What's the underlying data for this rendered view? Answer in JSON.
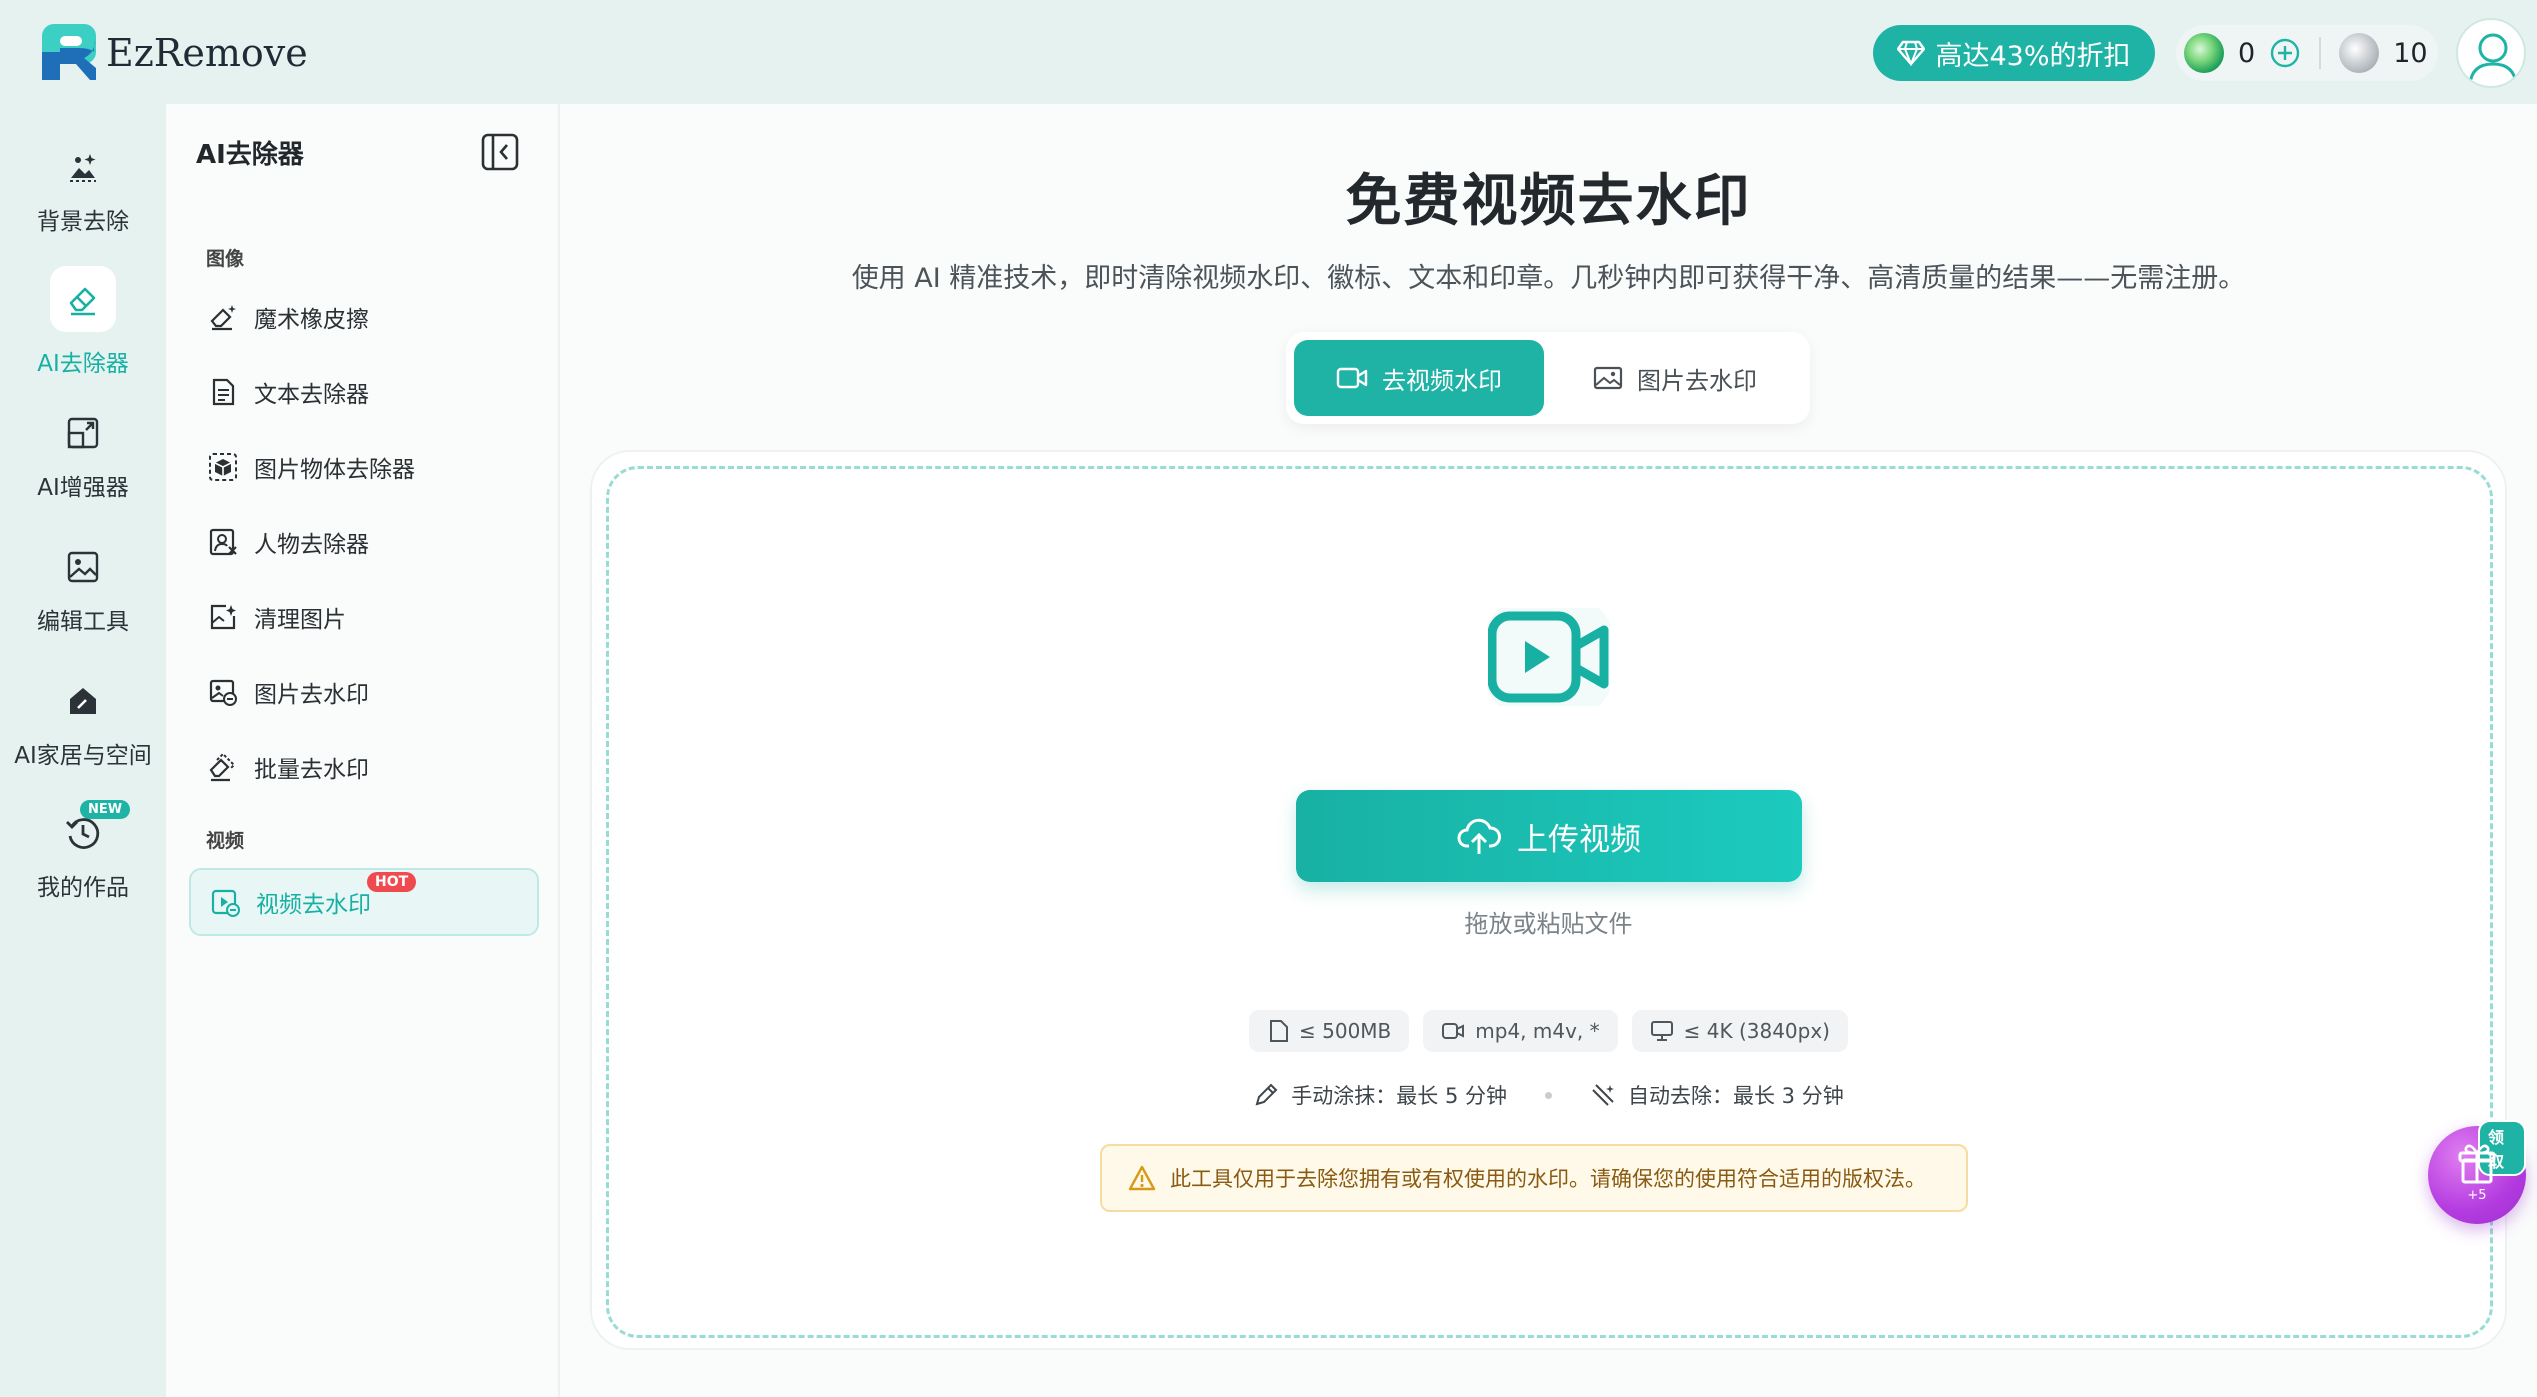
{
  "app": {
    "name": "EzRemove"
  },
  "header": {
    "promo_label": "高达43%的折扣",
    "credits_green": "0",
    "credits_grey": "10"
  },
  "rail": {
    "items": [
      {
        "label": "背景去除",
        "icon": "background-remove-icon"
      },
      {
        "label": "AI去除器",
        "icon": "eraser-icon",
        "active": true
      },
      {
        "label": "AI增强器",
        "icon": "enhance-icon"
      },
      {
        "label": "编辑工具",
        "icon": "image-edit-icon"
      },
      {
        "label": "AI家居与空间",
        "icon": "home-icon"
      },
      {
        "label": "我的作品",
        "icon": "history-icon",
        "badge": "NEW"
      }
    ]
  },
  "sidebar": {
    "title": "AI去除器",
    "section_image": "图像",
    "section_video": "视频",
    "items": [
      {
        "label": "魔术橡皮擦",
        "icon": "magic-eraser-icon"
      },
      {
        "label": "文本去除器",
        "icon": "text-document-icon"
      },
      {
        "label": "图片物体去除器",
        "icon": "object-cube-icon"
      },
      {
        "label": "人物去除器",
        "icon": "person-remove-icon"
      },
      {
        "label": "清理图片",
        "icon": "image-sparkle-icon"
      },
      {
        "label": "图片去水印",
        "icon": "image-watermark-icon"
      },
      {
        "label": "批量去水印",
        "icon": "batch-eraser-icon"
      }
    ],
    "video_item": {
      "label": "视频去水印",
      "badge": "HOT",
      "icon": "video-watermark-icon"
    }
  },
  "main": {
    "title": "免费视频去水印",
    "subtitle": "使用 AI 精准技术，即时清除视频水印、徽标、文本和印章。几秒钟内即可获得干净、高清质量的结果——无需注册。",
    "tabs": [
      {
        "label": "去视频水印",
        "active": true
      },
      {
        "label": "图片去水印",
        "active": false
      }
    ],
    "upload_label": "上传视频",
    "drop_hint": "拖放或粘贴文件",
    "chips": [
      {
        "label": "≤ 500MB",
        "icon": "file-icon"
      },
      {
        "label": "mp4, m4v, *",
        "icon": "video-icon"
      },
      {
        "label": "≤ 4K (3840px)",
        "icon": "monitor-icon"
      }
    ],
    "limits": {
      "manual": "手动涂抹：最长 5 分钟",
      "auto": "自动去除：最长 3 分钟"
    },
    "notice": "此工具仅用于去除您拥有或有权使用的水印。请确保您的使用符合适用的版权法。"
  },
  "gift": {
    "badge": "领取",
    "count": "+5"
  },
  "colors": {
    "accent": "#1fb3a6",
    "hot": "#ef4a4f",
    "gift": "#b43be0"
  }
}
